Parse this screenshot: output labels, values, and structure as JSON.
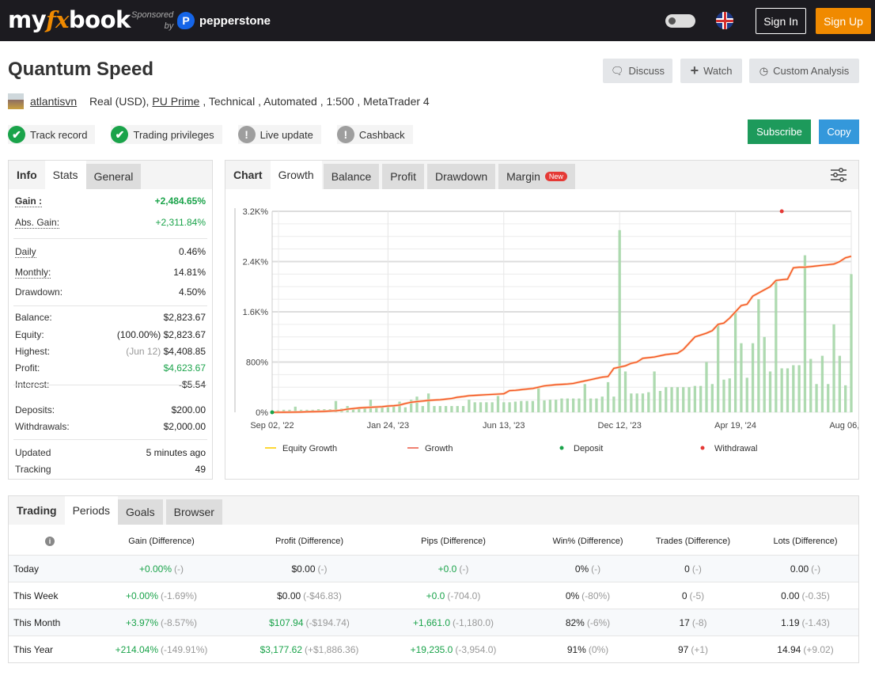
{
  "header": {
    "logo": {
      "pre": "my",
      "fx": "fx",
      "post": "book"
    },
    "sponsored_line1": "Sponsored",
    "sponsored_line2": "by",
    "sponsor": "pepperstone",
    "sign_in": "Sign In",
    "sign_up": "Sign Up",
    "theme_toggle_icon": "toggle-icon",
    "language_icon": "uk-flag-icon"
  },
  "title": "Quantum Speed",
  "meta": {
    "user": "atlantisvn",
    "account": "Real (USD),",
    "broker": "PU Prime",
    "rest": ", Technical , Automated , 1:500 , MetaTrader 4"
  },
  "badges": [
    {
      "label": "Track record",
      "status": "ok"
    },
    {
      "label": "Trading privileges",
      "status": "ok"
    },
    {
      "label": "Live update",
      "status": "warn"
    },
    {
      "label": "Cashback",
      "status": "warn"
    }
  ],
  "actions": {
    "discuss": "Discuss",
    "watch": "Watch",
    "custom": "Custom Analysis",
    "subscribe": "Subscribe",
    "copy": "Copy"
  },
  "colors": {
    "green": "#1aa34a",
    "accent": "#f08a00",
    "subscribe": "#1d9a5b",
    "copy": "#3498db",
    "growth": "#f4511e",
    "equity": "#fdd835",
    "bars": "#a5d6a7",
    "deposit": "#1aa34a",
    "withdrawal": "#e53935"
  },
  "stats": {
    "tabs": [
      "Info",
      "Stats",
      "General"
    ],
    "gain": {
      "k": "Gain :",
      "v": "+2,484.65%"
    },
    "abs_gain": {
      "k": "Abs. Gain:",
      "v": "+2,311.84%"
    },
    "daily": {
      "k": "Daily",
      "v": "0.46%"
    },
    "monthly": {
      "k": "Monthly:",
      "v": "14.81%"
    },
    "drawdown": {
      "k": "Drawdown:",
      "v": "4.50%"
    },
    "balance": {
      "k": "Balance:",
      "v": "$2,823.67"
    },
    "equity": {
      "k": "Equity:",
      "pre": "(100.00%)",
      "v": "$2,823.67"
    },
    "highest": {
      "k": "Highest:",
      "pre": "(Jun 12)",
      "v": "$4,408.85"
    },
    "profit": {
      "k": "Profit:",
      "v": "$4,623.67"
    },
    "interest": {
      "k": "Interest:",
      "v": "-$5.54"
    },
    "deposits": {
      "k": "Deposits:",
      "v": "$200.00"
    },
    "withdrawals": {
      "k": "Withdrawals:",
      "v": "$2,000.00"
    },
    "updated": {
      "k": "Updated",
      "v": "5 minutes ago"
    },
    "tracking": {
      "k": "Tracking",
      "v": "49"
    }
  },
  "chart_tabs": {
    "label": "Chart",
    "tabs": [
      "Growth",
      "Balance",
      "Profit",
      "Drawdown",
      "Margin"
    ],
    "new_badge": "New",
    "settings_icon": "sliders-icon"
  },
  "chart_data": {
    "type": "line",
    "ylim": [
      0,
      3200
    ],
    "y_ticks": [
      {
        "v": 0,
        "label": "0%"
      },
      {
        "v": 800,
        "label": "800%"
      },
      {
        "v": 1600,
        "label": "1.6K%"
      },
      {
        "v": 2400,
        "label": "2.4K%"
      },
      {
        "v": 3200,
        "label": "3.2K%"
      }
    ],
    "x_ticks": [
      {
        "i": 0,
        "label": "Sep 02, '22"
      },
      {
        "i": 20,
        "label": "Jan 24, '23"
      },
      {
        "i": 40,
        "label": "Jun 13, '23"
      },
      {
        "i": 60,
        "label": "Dec 12, '23"
      },
      {
        "i": 80,
        "label": "Apr 19, '24"
      },
      {
        "i": 100,
        "label": "Aug 06, '24"
      }
    ],
    "grid": true,
    "legend_position": "bottom",
    "series": [
      {
        "name": "Equity Growth",
        "color": "#fdd835"
      },
      {
        "name": "Growth",
        "color": "#f4511e",
        "values": [
          0,
          0,
          1,
          2,
          3,
          5,
          8,
          10,
          12,
          15,
          20,
          25,
          35,
          50,
          60,
          70,
          75,
          80,
          85,
          90,
          100,
          105,
          115,
          140,
          160,
          170,
          180,
          190,
          195,
          200,
          210,
          220,
          240,
          250,
          265,
          270,
          275,
          280,
          285,
          290,
          295,
          345,
          350,
          360,
          370,
          380,
          400,
          420,
          430,
          440,
          445,
          450,
          460,
          480,
          500,
          520,
          540,
          560,
          570,
          700,
          720,
          740,
          780,
          800,
          860,
          870,
          880,
          900,
          920,
          930,
          940,
          1000,
          1100,
          1200,
          1230,
          1260,
          1300,
          1400,
          1420,
          1500,
          1600,
          1700,
          1720,
          1850,
          1900,
          1950,
          2000,
          2100,
          2110,
          2120,
          2300,
          2310,
          2310,
          2320,
          2330,
          2340,
          2350,
          2360,
          2400,
          2460,
          2484
        ]
      },
      {
        "name": "Deposit",
        "color": "#1aa34a",
        "points": [
          {
            "i": 0,
            "v": 0
          }
        ]
      },
      {
        "name": "Withdrawal",
        "color": "#e53935",
        "points": [
          {
            "i": 88,
            "v": 3200
          }
        ]
      }
    ],
    "bars": [
      10,
      30,
      40,
      40,
      90,
      40,
      40,
      40,
      50,
      50,
      50,
      180,
      60,
      100,
      60,
      60,
      60,
      200,
      80,
      80,
      80,
      120,
      170,
      80,
      200,
      250,
      100,
      300,
      100,
      100,
      100,
      100,
      100,
      100,
      200,
      160,
      160,
      160,
      160,
      260,
      160,
      160,
      170,
      180,
      180,
      180,
      380,
      190,
      200,
      200,
      220,
      220,
      220,
      220,
      450,
      220,
      220,
      250,
      480,
      250,
      2900,
      650,
      300,
      300,
      300,
      320,
      650,
      340,
      400,
      400,
      400,
      400,
      400,
      420,
      420,
      800,
      450,
      1400,
      520,
      540,
      1600,
      1100,
      550,
      1100,
      1800,
      1200,
      650,
      2100,
      700,
      700,
      750,
      750,
      2500,
      850,
      450,
      900,
      450,
      1400,
      900,
      430,
      2200,
      200
    ]
  },
  "periods": {
    "tabs": [
      "Trading",
      "Periods",
      "Goals",
      "Browser"
    ],
    "info_icon": "info-icon",
    "columns": [
      "Gain (Difference)",
      "Profit (Difference)",
      "Pips (Difference)",
      "Win% (Difference)",
      "Trades (Difference)",
      "Lots (Difference)"
    ],
    "rows": [
      {
        "label": "Today",
        "cells": [
          [
            "+0.00%",
            "(-)"
          ],
          [
            "$0.00",
            "(-)"
          ],
          [
            "+0.0",
            "(-)"
          ],
          [
            "0%",
            "(-)"
          ],
          [
            "0",
            "(-)"
          ],
          [
            "0.00",
            "(-)"
          ]
        ]
      },
      {
        "label": "This Week",
        "cells": [
          [
            "+0.00%",
            "(-1.69%)"
          ],
          [
            "$0.00",
            "(-$46.83)"
          ],
          [
            "+0.0",
            "(-704.0)"
          ],
          [
            "0%",
            "(-80%)"
          ],
          [
            "0",
            "(-5)"
          ],
          [
            "0.00",
            "(-0.35)"
          ]
        ]
      },
      {
        "label": "This Month",
        "cells": [
          [
            "+3.97%",
            "(-8.57%)"
          ],
          [
            "$107.94",
            "(-$194.74)"
          ],
          [
            "+1,661.0",
            "(-1,180.0)"
          ],
          [
            "82%",
            "(-6%)"
          ],
          [
            "17",
            "(-8)"
          ],
          [
            "1.19",
            "(-1.43)"
          ]
        ]
      },
      {
        "label": "This Year",
        "cells": [
          [
            "+214.04%",
            "(-149.91%)"
          ],
          [
            "$3,177.62",
            "(+$1,886.36)"
          ],
          [
            "+19,235.0",
            "(-3,954.0)"
          ],
          [
            "91%",
            "(0%)"
          ],
          [
            "97",
            "(+1)"
          ],
          [
            "14.94",
            "(+9.02)"
          ]
        ]
      }
    ]
  }
}
